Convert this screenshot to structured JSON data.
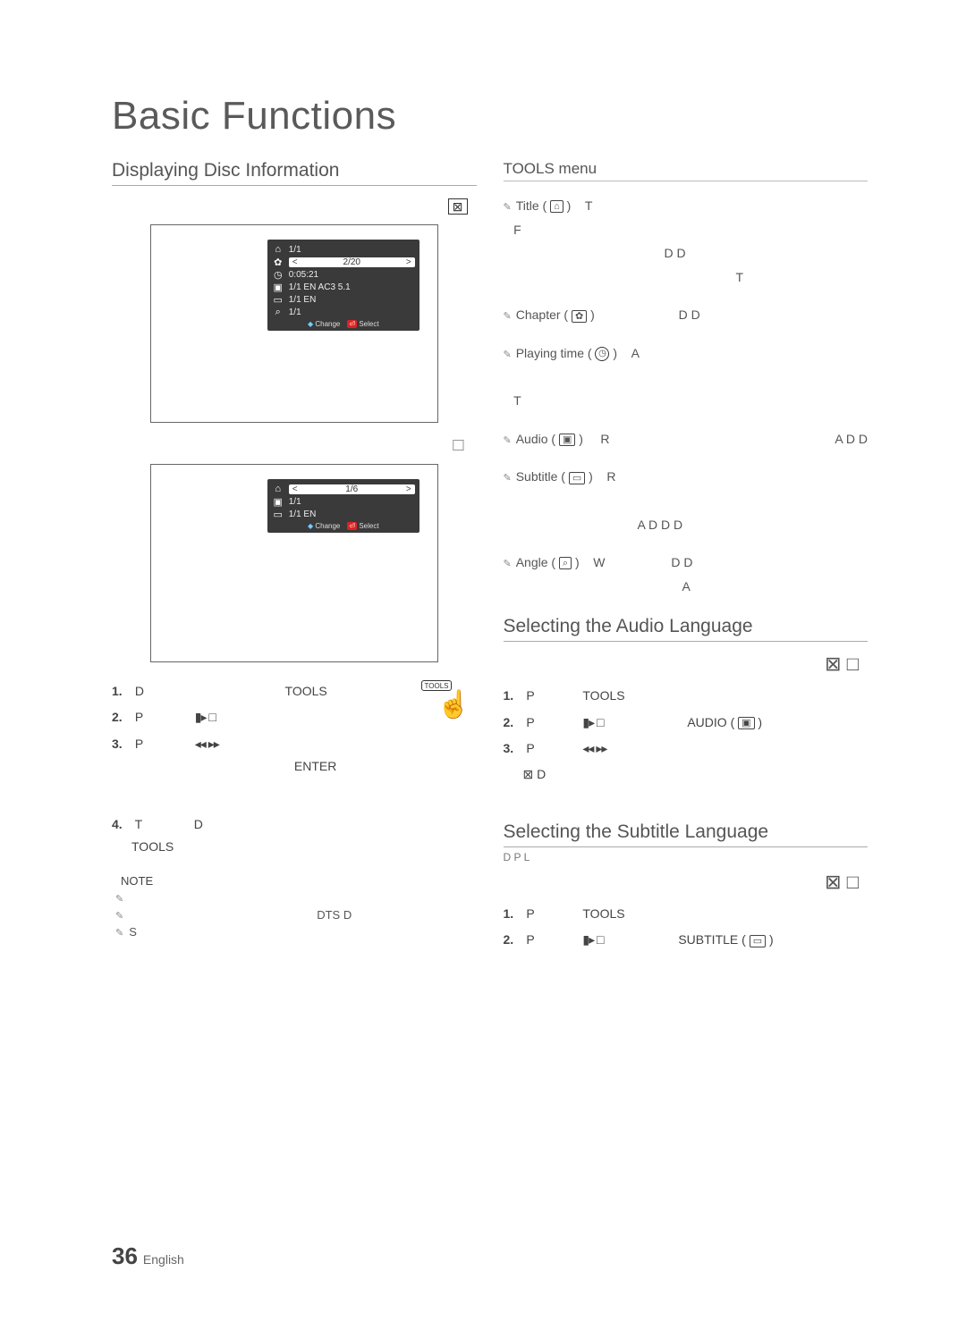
{
  "title": "Basic Functions",
  "left": {
    "section": "Displaying Disc Information",
    "top_right_icon": "⊠",
    "osd1": {
      "title": "1/1",
      "chapter": "2/20",
      "time": "0:05:21",
      "audio": "1/1 EN AC3 5.1",
      "sub": "1/1 EN",
      "angle": "1/1",
      "foot_change": "Change",
      "foot_select": "Select"
    },
    "osd2": {
      "title": "1/6",
      "audio": "1/1",
      "sub": "1/1 EN",
      "foot_change": "Change",
      "foot_select": "Select"
    },
    "steps": {
      "s1a": "D",
      "s1b": "TOOLS",
      "s2a": "P",
      "s2b": "▮▸ □",
      "s3a": "P",
      "s3b": "◂◂ ▸▸",
      "s3c": "ENTER",
      "s4a": "T",
      "s4b": "D",
      "s4c": "TOOLS"
    },
    "note_head": "NOTE",
    "notes": {
      "n1": "",
      "n2": "DTS   D",
      "n3": "S"
    },
    "tools_btn": "TOOLS"
  },
  "right": {
    "tools_menu": "TOOLS menu",
    "items": {
      "title": {
        "label": "Title",
        "letters": "T",
        "l2": "F",
        "l3": "D   D",
        "l4": "T"
      },
      "chapter": {
        "label": "Chapter",
        "letters": "D   D"
      },
      "playing": {
        "label": "Playing time",
        "letters": "A",
        "l2": "T"
      },
      "audio": {
        "label": "Audio",
        "letters": "R",
        "l2": "A D   D"
      },
      "subtitle": {
        "label": "Subtitle",
        "letters": "R",
        "l2": "A D   D D"
      },
      "angle": {
        "label": "Angle",
        "letters": "W",
        "l2": "D   D",
        "l3": "A"
      }
    },
    "audio_sec": {
      "title": "Selecting the Audio Language",
      "icons": "⊠   □",
      "s1": "P",
      "s1b": "TOOLS",
      "s2": "P",
      "s2b": "▮▸ □",
      "s2c": "AUDIO",
      "s3": "P",
      "s3b": "◂◂ ▸▸",
      "s4": "⊠ D"
    },
    "sub_sec": {
      "title": "Selecting the Subtitle Language",
      "below": "D                    P        L",
      "icons": "⊠   □",
      "s1": "P",
      "s1b": "TOOLS",
      "s2": "P",
      "s2b": "▮▸ □",
      "s2c": "SUBTITLE"
    }
  },
  "footer": {
    "page": "36",
    "lang": "English"
  }
}
